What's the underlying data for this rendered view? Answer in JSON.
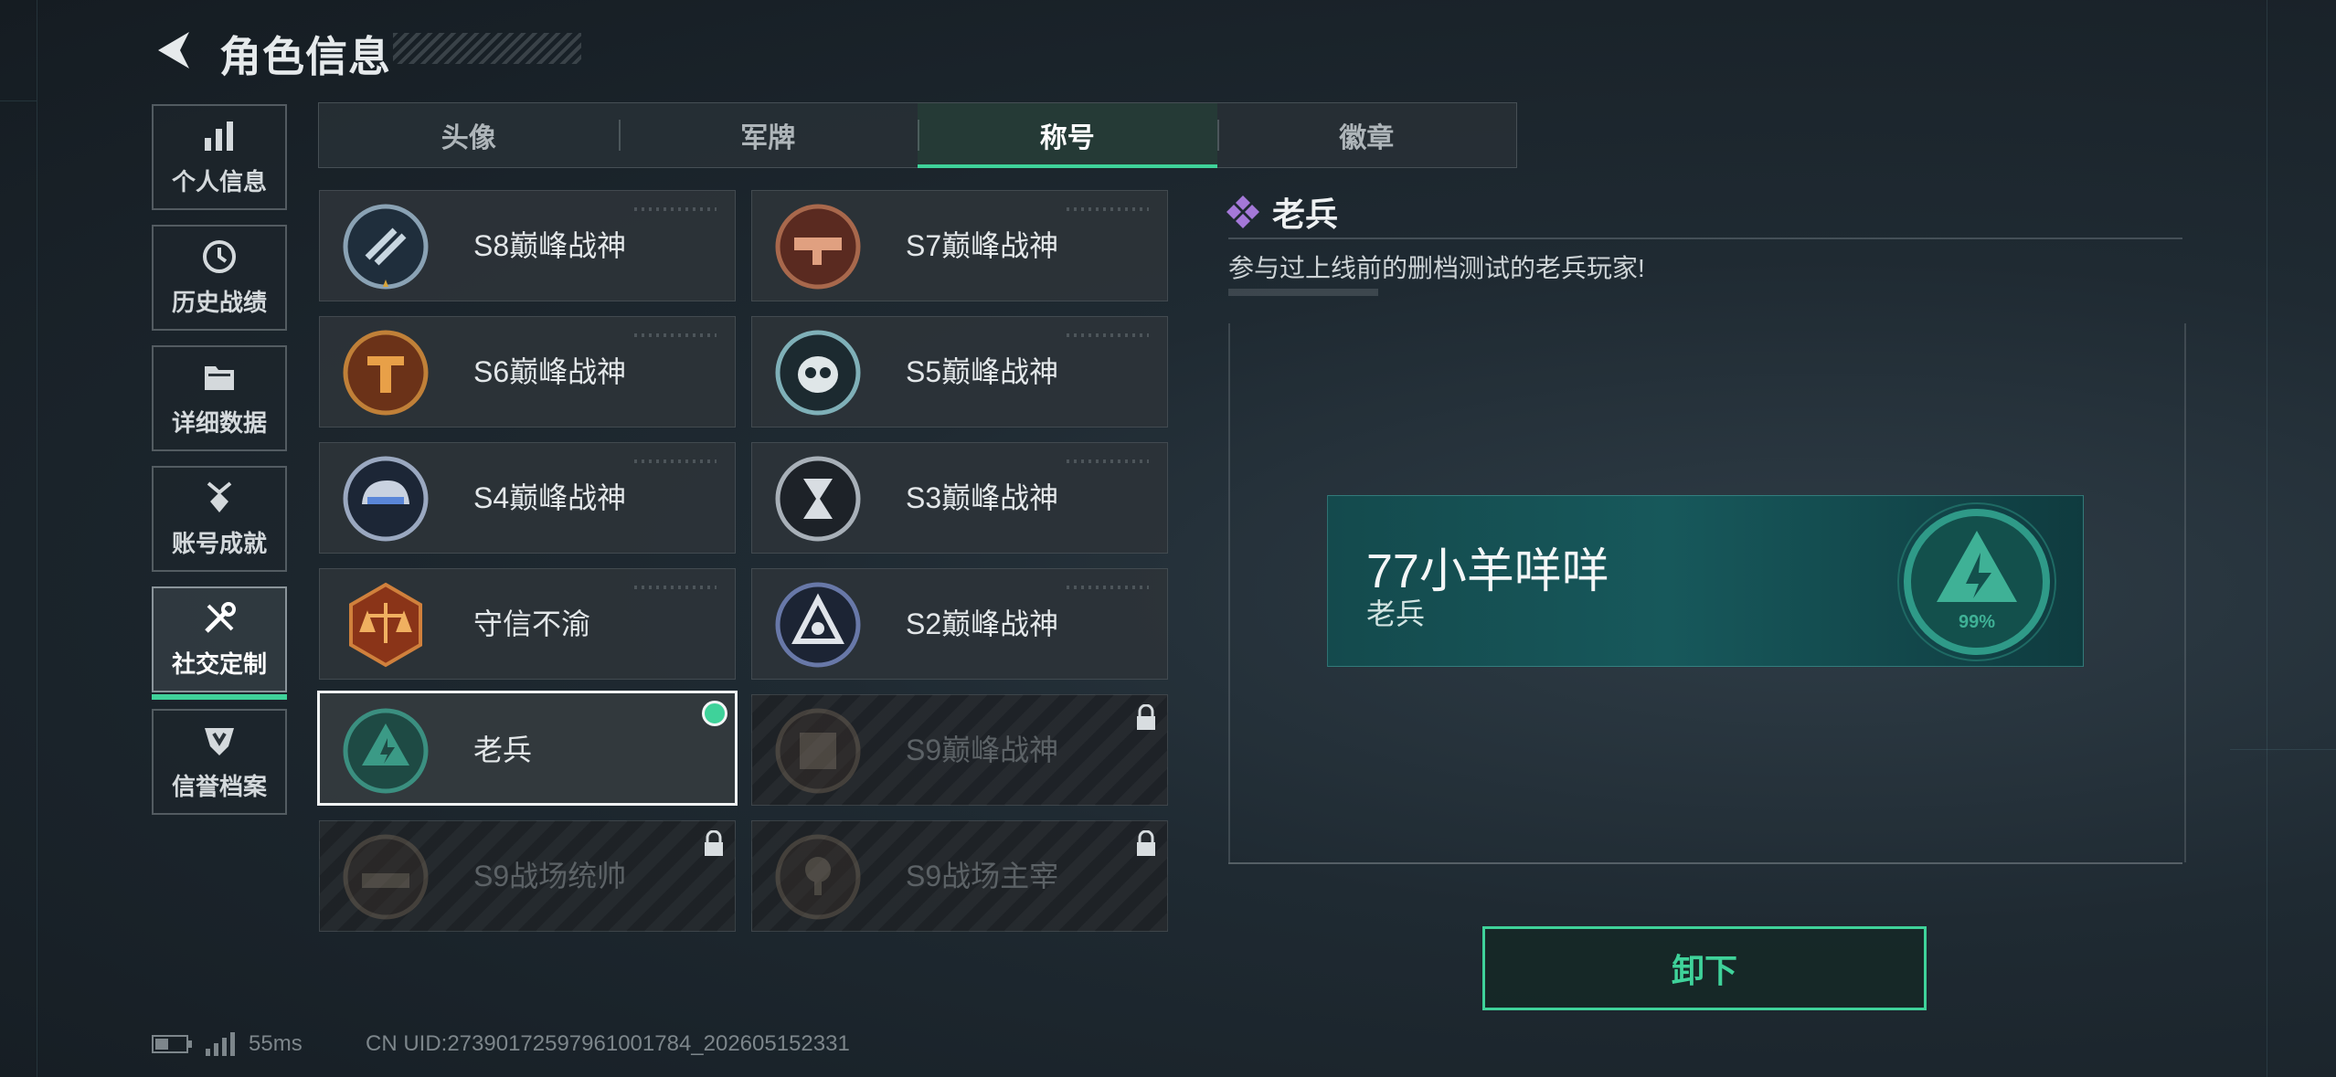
{
  "header": {
    "title": "角色信息"
  },
  "sidebar": {
    "items": [
      {
        "label": "个人信息",
        "icon": "bar-chart-icon"
      },
      {
        "label": "历史战绩",
        "icon": "clock-icon"
      },
      {
        "label": "详细数据",
        "icon": "folder-icon"
      },
      {
        "label": "账号成就",
        "icon": "medal-icon"
      },
      {
        "label": "社交定制",
        "icon": "tools-icon",
        "active": true
      },
      {
        "label": "信誉档案",
        "icon": "shield-icon"
      }
    ]
  },
  "tabs": [
    {
      "label": "头像"
    },
    {
      "label": "军牌"
    },
    {
      "label": "称号",
      "active": true
    },
    {
      "label": "徽章"
    }
  ],
  "titles": [
    {
      "name": "S8巅峰战神",
      "state": "unlocked"
    },
    {
      "name": "S7巅峰战神",
      "state": "unlocked"
    },
    {
      "name": "S6巅峰战神",
      "state": "unlocked"
    },
    {
      "name": "S5巅峰战神",
      "state": "unlocked"
    },
    {
      "name": "S4巅峰战神",
      "state": "unlocked"
    },
    {
      "name": "S3巅峰战神",
      "state": "unlocked"
    },
    {
      "name": "守信不渝",
      "state": "unlocked"
    },
    {
      "name": "S2巅峰战神",
      "state": "unlocked"
    },
    {
      "name": "老兵",
      "state": "selected-equipped"
    },
    {
      "name": "S9巅峰战神",
      "state": "locked"
    },
    {
      "name": "S9战场统帅",
      "state": "locked"
    },
    {
      "name": "S9战场主宰",
      "state": "locked"
    }
  ],
  "detail": {
    "title": "老兵",
    "description": "参与过上线前的删档测试的老兵玩家!",
    "preview": {
      "player_name": "77小羊咩咩",
      "title": "老兵",
      "emblem_text": "99%"
    },
    "action_label": "卸下"
  },
  "status_bar": {
    "ping": "55ms",
    "uid": "CN UID:27390172597961001784_202605152331"
  },
  "colors": {
    "accent": "#3fd29a",
    "preview_bg": "#17585b"
  }
}
